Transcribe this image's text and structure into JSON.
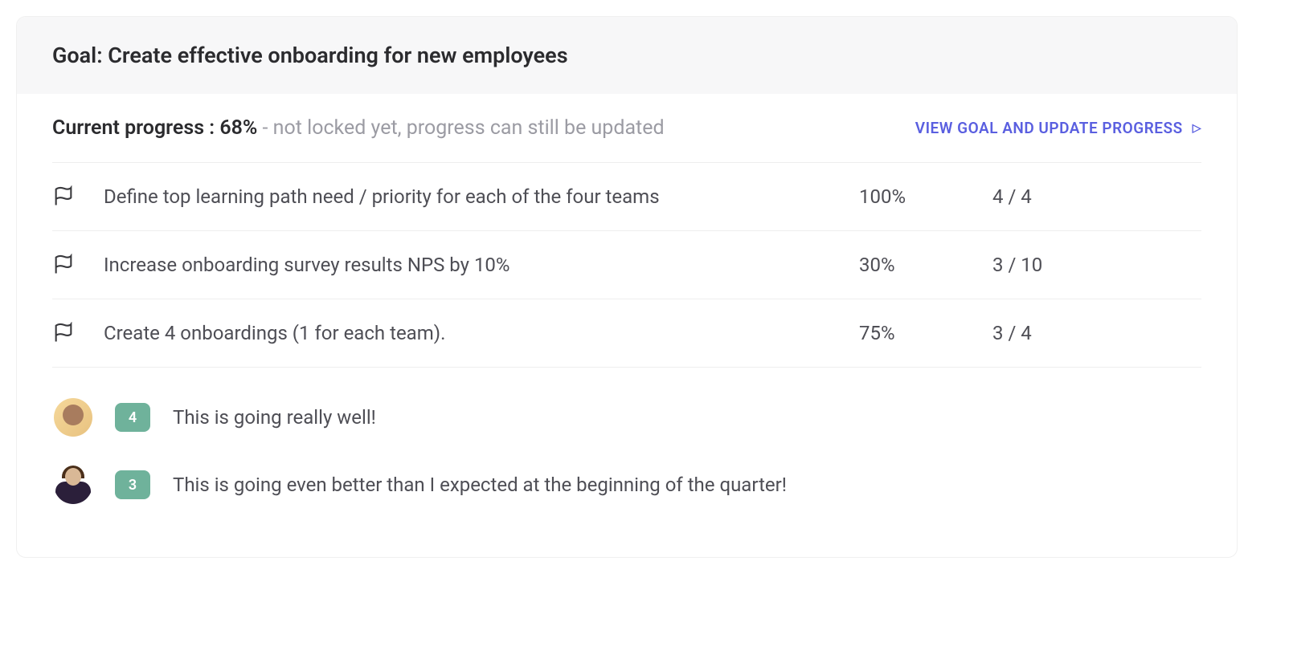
{
  "goal": {
    "title_prefix": "Goal: ",
    "title": "Create effective onboarding for new employees"
  },
  "progress": {
    "label_prefix": "Current progress : ",
    "percent": "68%",
    "note": " - not locked yet, progress can still be updated",
    "view_link": "VIEW GOAL AND UPDATE PROGRESS"
  },
  "subgoals": [
    {
      "title": "Define top learning path need / priority for each of the four teams",
      "percent": "100%",
      "count": "4 / 4"
    },
    {
      "title": "Increase onboarding survey results NPS by 10%",
      "percent": "30%",
      "count": "3 / 10"
    },
    {
      "title": "Create 4 onboardings (1 for each team).",
      "percent": "75%",
      "count": "3 / 4"
    }
  ],
  "comments": [
    {
      "score": "4",
      "text": "This is going really well!"
    },
    {
      "score": "3",
      "text": "This is going even better than I expected at the beginning of the quarter!"
    }
  ]
}
